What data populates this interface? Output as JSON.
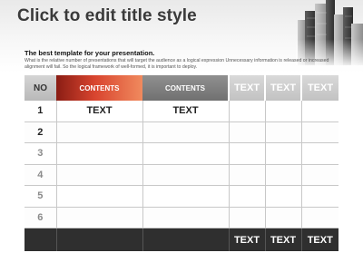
{
  "title": "Click to edit title style",
  "subtitle": "The best template for your presentation.",
  "body": "What is the relative number of presentations that will target the audience as a logical expression Unnecessary information is released or increased alignment will fail. So the logical framework of well-formed, it is important to deploy.",
  "table": {
    "header": [
      "NO",
      "CONTENTS",
      "CONTENTS",
      "TEXT",
      "TEXT",
      "TEXT"
    ],
    "rows": [
      [
        "1",
        "TEXT",
        "TEXT",
        "",
        "",
        ""
      ],
      [
        "2",
        "",
        "",
        "",
        "",
        ""
      ],
      [
        "3",
        "",
        "",
        "",
        "",
        ""
      ],
      [
        "4",
        "",
        "",
        "",
        "",
        ""
      ],
      [
        "5",
        "",
        "",
        "",
        "",
        ""
      ],
      [
        "6",
        "",
        "",
        "",
        "",
        ""
      ]
    ],
    "footer": [
      "",
      "",
      "",
      "TEXT",
      "TEXT",
      "TEXT"
    ]
  },
  "colors": {
    "accent": "#d9452f",
    "header_gray": "#808080",
    "footer": "#2f2f2f"
  },
  "icons": {
    "decoration": "city-buildings-image"
  }
}
